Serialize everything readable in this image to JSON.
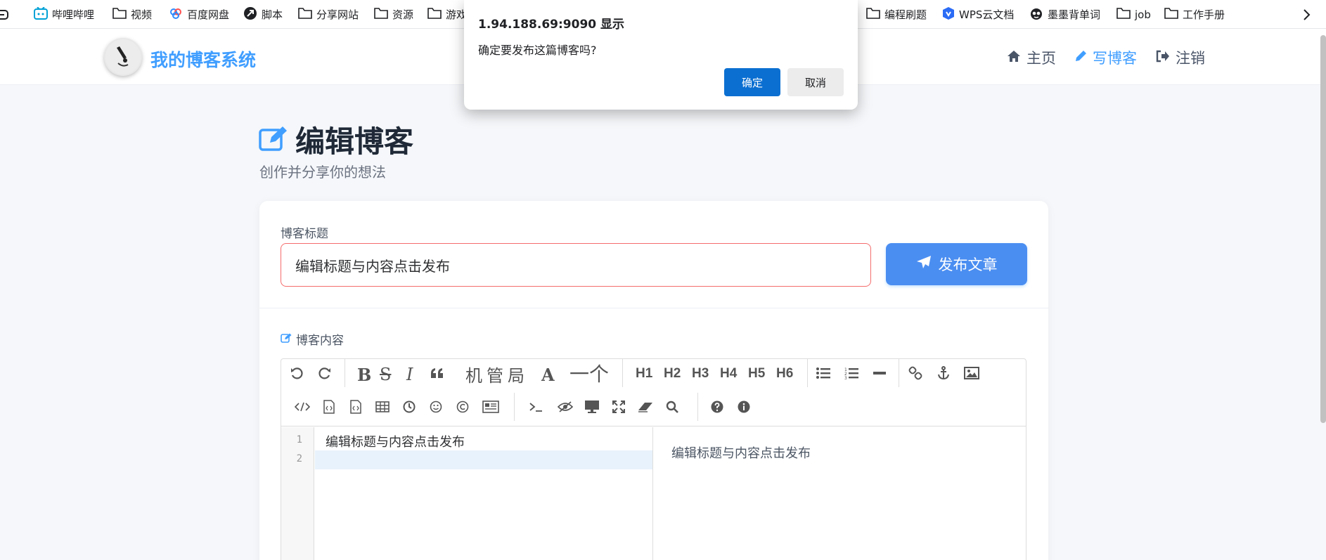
{
  "bookmarks": {
    "items": [
      {
        "label": "哔哩哔哩",
        "icon": "bilibili-icon"
      },
      {
        "label": "视频",
        "icon": "folder-icon"
      },
      {
        "label": "百度网盘",
        "icon": "baidu-netdisk-icon"
      },
      {
        "label": "脚本",
        "icon": "script-icon"
      },
      {
        "label": "分享网站",
        "icon": "folder-icon"
      },
      {
        "label": "资源",
        "icon": "folder-icon"
      },
      {
        "label": "游戏",
        "icon": "folder-icon"
      },
      {
        "label": "编程刷题",
        "icon": "folder-icon"
      },
      {
        "label": "WPS云文档",
        "icon": "wps-icon"
      },
      {
        "label": "墨墨背单词",
        "icon": "momo-icon"
      },
      {
        "label": "job",
        "icon": "folder-icon"
      },
      {
        "label": "工作手册",
        "icon": "folder-icon"
      }
    ]
  },
  "header": {
    "brand": "我的博客系统",
    "nav": [
      {
        "label": "主页",
        "icon": "home-icon"
      },
      {
        "label": "写博客",
        "icon": "pencil-icon"
      },
      {
        "label": "注销",
        "icon": "sign-out-icon"
      }
    ]
  },
  "page": {
    "title": "编辑博客",
    "subtitle": "创作并分享你的想法"
  },
  "form": {
    "title_label": "博客标题",
    "title_value": "编辑标题与内容点击发布",
    "publish_label": "发布文章",
    "content_label": "博客内容"
  },
  "toolbar": {
    "text_tools": [
      "机",
      "管",
      "局"
    ],
    "font_tool": "A",
    "line_tool": "一个",
    "headings": [
      "H1",
      "H2",
      "H3",
      "H4",
      "H5",
      "H6"
    ]
  },
  "editor": {
    "line_numbers": [
      "1",
      "2"
    ],
    "lines": [
      "编辑标题与内容点击发布",
      ""
    ],
    "preview_text": "编辑标题与内容点击发布"
  },
  "dialog": {
    "title": "1.94.188.69:9090 显示",
    "message": "确定要发布这篇博客吗?",
    "ok_label": "确定",
    "cancel_label": "取消"
  },
  "colors": {
    "accent": "#409eff",
    "publish_button": "#4b8ef1",
    "dialog_ok": "#0b6fd1",
    "input_error_border": "#f56c6c"
  }
}
